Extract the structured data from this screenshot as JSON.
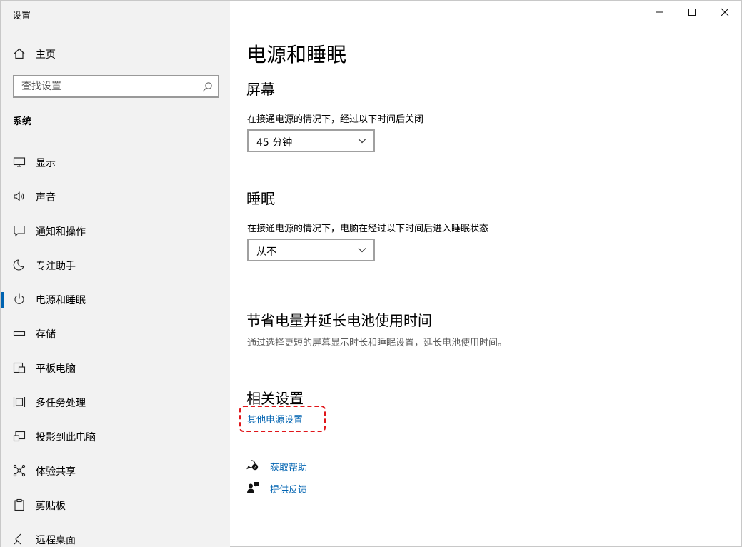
{
  "window": {
    "title": "设置",
    "controls": {
      "minimize": "minimize",
      "maximize": "maximize",
      "close": "close"
    }
  },
  "sidebar": {
    "home_label": "主页",
    "search_placeholder": "查找设置",
    "section_label": "系统",
    "items": [
      {
        "label": "显示",
        "icon": "monitor-icon"
      },
      {
        "label": "声音",
        "icon": "speaker-icon"
      },
      {
        "label": "通知和操作",
        "icon": "notification-icon"
      },
      {
        "label": "专注助手",
        "icon": "moon-icon"
      },
      {
        "label": "电源和睡眠",
        "icon": "power-icon",
        "active": true
      },
      {
        "label": "存储",
        "icon": "storage-icon"
      },
      {
        "label": "平板电脑",
        "icon": "tablet-icon"
      },
      {
        "label": "多任务处理",
        "icon": "multitask-icon"
      },
      {
        "label": "投影到此电脑",
        "icon": "project-icon"
      },
      {
        "label": "体验共享",
        "icon": "share-icon"
      },
      {
        "label": "剪贴板",
        "icon": "clipboard-icon"
      },
      {
        "label": "远程桌面",
        "icon": "remote-icon"
      }
    ]
  },
  "main": {
    "title": "电源和睡眠",
    "screen": {
      "heading": "屏幕",
      "description": "在接通电源的情况下，经过以下时间后关闭",
      "selected": "45 分钟"
    },
    "sleep": {
      "heading": "睡眠",
      "description": "在接通电源的情况下，电脑在经过以下时间后进入睡眠状态",
      "selected": "从不"
    },
    "battery": {
      "heading": "节省电量并延长电池使用时间",
      "description": "通过选择更短的屏幕显示时长和睡眠设置，延长电池使用时间。"
    },
    "related": {
      "heading": "相关设置",
      "link": "其他电源设置"
    },
    "help": {
      "get_help": "获取帮助",
      "feedback": "提供反馈"
    }
  },
  "colors": {
    "accent": "#0063b1",
    "sidebar_bg": "#f2f2f2",
    "highlight_border": "#e0161a"
  }
}
